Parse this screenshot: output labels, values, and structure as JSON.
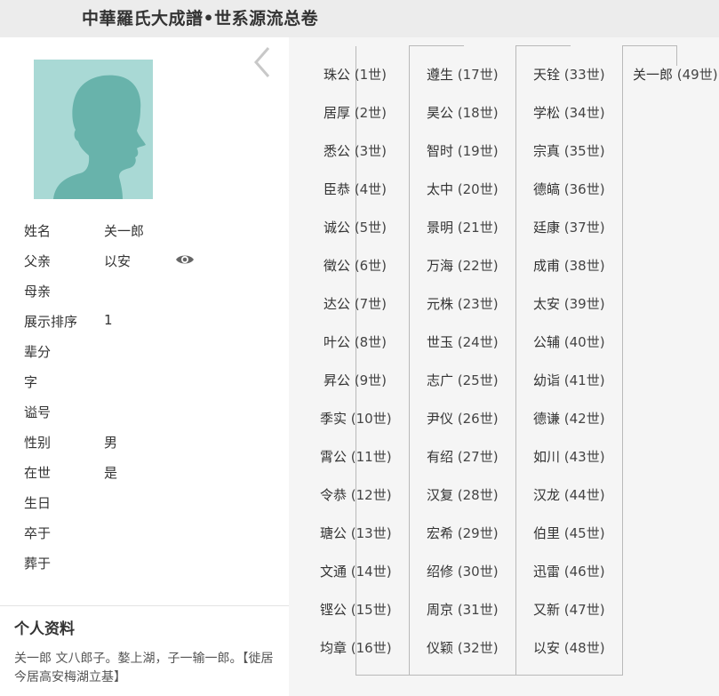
{
  "header": {
    "title": "中華羅氏大成譜•世系源流总卷"
  },
  "person": {
    "fields": [
      {
        "label": "姓名",
        "value": "关一郎"
      },
      {
        "label": "父亲",
        "value": "以安"
      },
      {
        "label": "母亲",
        "value": ""
      },
      {
        "label": "展示排序",
        "value": "1"
      },
      {
        "label": "辈分",
        "value": ""
      },
      {
        "label": "字",
        "value": ""
      },
      {
        "label": "谥号",
        "value": ""
      },
      {
        "label": "性别",
        "value": "男"
      },
      {
        "label": "在世",
        "value": "是"
      },
      {
        "label": "生日",
        "value": ""
      },
      {
        "label": "卒于",
        "value": ""
      },
      {
        "label": "葬于",
        "value": ""
      }
    ]
  },
  "profile": {
    "title": "个人资料",
    "text": "关一郎  文八郎子。嫯上湖，子一输一郎。【徙居今居高安梅湖立基】"
  },
  "lineage": [
    [
      {
        "name": "珠公",
        "gen": "(1世)"
      },
      {
        "name": "居厚",
        "gen": "(2世)"
      },
      {
        "name": "悉公",
        "gen": "(3世)"
      },
      {
        "name": "臣恭",
        "gen": "(4世)"
      },
      {
        "name": "诚公",
        "gen": "(5世)"
      },
      {
        "name": "徵公",
        "gen": "(6世)"
      },
      {
        "name": "达公",
        "gen": "(7世)"
      },
      {
        "name": "叶公",
        "gen": "(8世)"
      },
      {
        "name": "昇公",
        "gen": "(9世)"
      },
      {
        "name": "季实",
        "gen": "(10世)"
      },
      {
        "name": "霄公",
        "gen": "(11世)"
      },
      {
        "name": "令恭",
        "gen": "(12世)"
      },
      {
        "name": "瑭公",
        "gen": "(13世)"
      },
      {
        "name": "文通",
        "gen": "(14世)"
      },
      {
        "name": "铿公",
        "gen": "(15世)"
      },
      {
        "name": "均章",
        "gen": "(16世)"
      }
    ],
    [
      {
        "name": "遵生",
        "gen": "(17世)"
      },
      {
        "name": "昊公",
        "gen": "(18世)"
      },
      {
        "name": "智时",
        "gen": "(19世)"
      },
      {
        "name": "太中",
        "gen": "(20世)"
      },
      {
        "name": "景明",
        "gen": "(21世)"
      },
      {
        "name": "万海",
        "gen": "(22世)"
      },
      {
        "name": "元株",
        "gen": "(23世)"
      },
      {
        "name": "世玉",
        "gen": "(24世)"
      },
      {
        "name": "志广",
        "gen": "(25世)"
      },
      {
        "name": "尹仪",
        "gen": "(26世)"
      },
      {
        "name": "有绍",
        "gen": "(27世)"
      },
      {
        "name": "汉复",
        "gen": "(28世)"
      },
      {
        "name": "宏希",
        "gen": "(29世)"
      },
      {
        "name": "绍修",
        "gen": "(30世)"
      },
      {
        "name": "周京",
        "gen": "(31世)"
      },
      {
        "name": "仪颖",
        "gen": "(32世)"
      }
    ],
    [
      {
        "name": "天铨",
        "gen": "(33世)"
      },
      {
        "name": "学松",
        "gen": "(34世)"
      },
      {
        "name": "宗真",
        "gen": "(35世)"
      },
      {
        "name": "德皜",
        "gen": "(36世)"
      },
      {
        "name": "廷康",
        "gen": "(37世)"
      },
      {
        "name": "成甫",
        "gen": "(38世)"
      },
      {
        "name": "太安",
        "gen": "(39世)"
      },
      {
        "name": "公辅",
        "gen": "(40世)"
      },
      {
        "name": "幼诣",
        "gen": "(41世)"
      },
      {
        "name": "德谦",
        "gen": "(42世)"
      },
      {
        "name": "如川",
        "gen": "(43世)"
      },
      {
        "name": "汉龙",
        "gen": "(44世)"
      },
      {
        "name": "伯里",
        "gen": "(45世)"
      },
      {
        "name": "迅雷",
        "gen": "(46世)"
      },
      {
        "name": "又新",
        "gen": "(47世)"
      },
      {
        "name": "以安",
        "gen": "(48世)"
      }
    ],
    [
      {
        "name": "关一郎",
        "gen": "(49世)"
      }
    ]
  ]
}
